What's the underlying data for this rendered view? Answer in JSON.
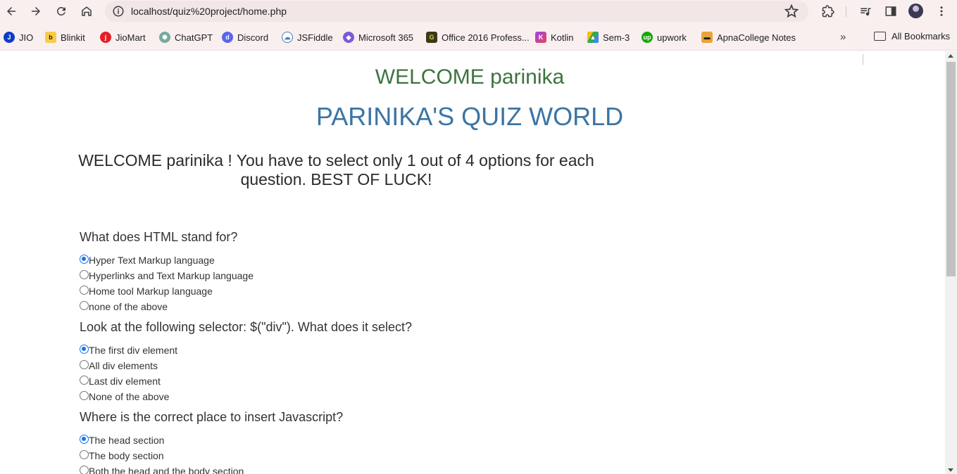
{
  "browser": {
    "url": "localhost/quiz%20project/home.php"
  },
  "bookmarks": [
    {
      "label": "JIO",
      "icon": "jio-icon",
      "color": "#0f3cc9"
    },
    {
      "label": "Blinkit",
      "icon": "blinkit-icon",
      "color": "#f8cb46"
    },
    {
      "label": "JioMart",
      "icon": "jiomart-icon",
      "color": "#e41e26"
    },
    {
      "label": "ChatGPT",
      "icon": "chatgpt-icon",
      "color": "#74aa9c"
    },
    {
      "label": "Discord",
      "icon": "discord-icon",
      "color": "#5865f2"
    },
    {
      "label": "JSFiddle",
      "icon": "jsfiddle-icon",
      "color": "#4679bd"
    },
    {
      "label": "Microsoft 365",
      "icon": "microsoft365-icon",
      "color": "#7b5cd6"
    },
    {
      "label": "Office 2016 Profess...",
      "icon": "office-icon",
      "color": "#3a3a1a"
    },
    {
      "label": "Kotlin",
      "icon": "kotlin-icon",
      "color": "#a340e8"
    },
    {
      "label": "Sem-3",
      "icon": "google-drive-icon",
      "color": "#34a853"
    },
    {
      "label": "upwork",
      "icon": "upwork-icon",
      "color": "#14a800"
    },
    {
      "label": "ApnaCollege Notes",
      "icon": "apnacollege-icon",
      "color": "#e8a33a"
    }
  ],
  "all_bookmarks": "All Bookmarks",
  "page": {
    "welcome_title": "WELCOME parinika",
    "site_title": "PARINIKA'S QUIZ WORLD",
    "instructions": "WELCOME parinika ! You have to select only 1 out of 4 options for each question. BEST OF LUCK!"
  },
  "questions": [
    {
      "text": "What does HTML stand for?",
      "options": [
        "Hyper Text Markup language",
        "Hyperlinks and Text Markup language",
        "Home tool Markup language",
        "none of the above"
      ],
      "selected": 0
    },
    {
      "text": "Look at the following selector: $(\"div\"). What does it select?",
      "options": [
        "The first div element",
        "All div elements",
        "Last div element",
        "None of the above"
      ],
      "selected": 0
    },
    {
      "text": "Where is the correct place to insert Javascript?",
      "options": [
        "The head section",
        "The body section",
        "Both the head and the body section"
      ],
      "selected": 0
    }
  ],
  "colors": {
    "welcome": "#3d7340",
    "title": "#3b74a5",
    "radio_selected": "#1a73e8"
  }
}
